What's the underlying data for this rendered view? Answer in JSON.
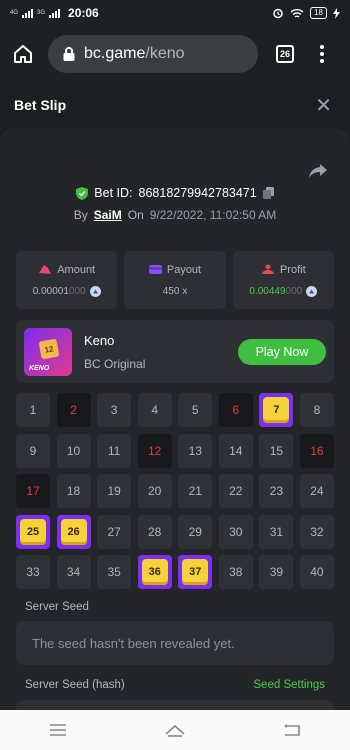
{
  "status": {
    "net1": "4G",
    "net2": "3G",
    "time": "20:06",
    "battery": "18"
  },
  "browser": {
    "url_domain": "bc.game",
    "url_path": "/keno",
    "tab_count": "26"
  },
  "slip": {
    "title": "Bet Slip",
    "bet_id_label": "Bet ID:",
    "bet_id": "86818279942783471",
    "by_label": "By",
    "user": "SaiM",
    "on_label": "On",
    "date": "9/22/2022, 11:02:50 AM"
  },
  "stats": {
    "amount_label": "Amount",
    "amount_value": "0.00001",
    "amount_dim": "000",
    "payout_label": "Payout",
    "payout_value": "450 x",
    "profit_label": "Profit",
    "profit_value": "0.00449",
    "profit_dim": "000"
  },
  "game": {
    "name": "Keno",
    "provider": "BC Original",
    "play_label": "Play Now",
    "thumb_label": "KENO",
    "thumb_cube": "12"
  },
  "grid": {
    "numbers": [
      "1",
      "2",
      "3",
      "4",
      "5",
      "6",
      "7",
      "8",
      "9",
      "10",
      "11",
      "12",
      "13",
      "14",
      "15",
      "16",
      "17",
      "18",
      "19",
      "20",
      "21",
      "22",
      "23",
      "24",
      "25",
      "26",
      "27",
      "28",
      "29",
      "30",
      "31",
      "32",
      "33",
      "34",
      "35",
      "36",
      "37",
      "38",
      "39",
      "40"
    ],
    "drawn": [
      "2",
      "6",
      "12",
      "16",
      "17"
    ],
    "picked": [
      "7",
      "25",
      "26",
      "36",
      "37"
    ]
  },
  "seed": {
    "server_seed_label": "Server Seed",
    "server_seed_value": "The seed hasn't been revealed yet.",
    "hash_label": "Server Seed (hash)",
    "settings_label": "Seed Settings"
  },
  "colors": {
    "accent_green": "#3fbf3f",
    "picked_purple": "#7c2ff0",
    "drawn_red": "#e53b3b"
  }
}
